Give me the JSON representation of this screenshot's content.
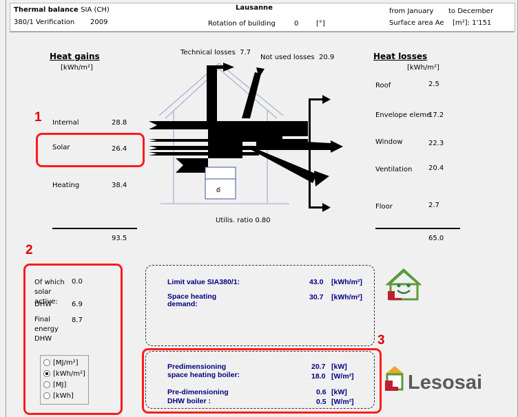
{
  "header": {
    "title": "Thermal balance",
    "title_norm": "SIA (CH)",
    "verification": "380/1 Verification",
    "year": "2009",
    "location": "Lausanne",
    "rotation_label": "Rotation of building",
    "rotation_value": "0",
    "rotation_unit": "[°]",
    "from_label": "from January",
    "to_label": "to December",
    "area_label": "Surface area Ae",
    "area_value": "[m²]: 1'151"
  },
  "gains": {
    "title": "Heat gains",
    "unit": "[kWh/m²]",
    "items": [
      {
        "label": "Internal",
        "value": "28.8"
      },
      {
        "label": "Solar",
        "value": "26.4"
      },
      {
        "label": "Heating",
        "value": "38.4"
      }
    ],
    "total": "93.5"
  },
  "losses": {
    "title": "Heat losses",
    "unit": "[kWh/m²]",
    "items": [
      {
        "label": "Roof",
        "value": "2.5"
      },
      {
        "label": "Envelope eleme",
        "value": "17.2"
      },
      {
        "label": "Window",
        "value": "22.3"
      },
      {
        "label": "Ventilation",
        "value": "20.4"
      },
      {
        "label": "Floor",
        "value": "2.7"
      }
    ],
    "total": "65.0"
  },
  "diagram": {
    "technical_losses_label": "Technical losses",
    "technical_losses_value": "7.7",
    "not_used_label": "Not used losses",
    "not_used_value": "20.9",
    "utilisation_label": "Utilis. ratio",
    "utilisation_value": "0.80"
  },
  "solar_panel": {
    "solar_active_label": "Of which solar active:",
    "solar_active_value": "0.0",
    "dhw_label": "DHW",
    "dhw_value": "6.9",
    "final_energy_label": "Final energy DHW",
    "final_energy_value": "8.7"
  },
  "units": {
    "options": [
      "[MJ/m²]",
      "[kWh/m²]",
      "[MJ]",
      "[kWh]"
    ],
    "selected": "[kWh/m²]"
  },
  "results": {
    "limit_label": "Limit value SIA380/1:",
    "limit_value": "43.0",
    "limit_unit": "[kWh/m²]",
    "demand_label": "Space heating demand:",
    "demand_value": "30.7",
    "demand_unit": "[kWh/m²]",
    "boiler_label_1": "Predimensioning",
    "boiler_label_2": "space heating boiler:",
    "boiler_kw_value": "20.7",
    "boiler_kw_unit": "[kW]",
    "boiler_wm2_value": "18.0",
    "boiler_wm2_unit": "[W/m²]",
    "dhw_label_1": "Pre-dimensioning",
    "dhw_label_2": "DHW boiler :",
    "dhw_kw_value": "0.6",
    "dhw_kw_unit": "[kW]",
    "dhw_wm2_value": "0.5",
    "dhw_wm2_unit": "[W/m²]"
  },
  "annotations": [
    "1",
    "2",
    "3"
  ],
  "brand": {
    "name": "Lesosai"
  },
  "colors": {
    "accent_red": "#ff1a1a",
    "label_blue": "#000080",
    "brand_green": "#5a9a3a",
    "brand_red": "#c0202e"
  }
}
